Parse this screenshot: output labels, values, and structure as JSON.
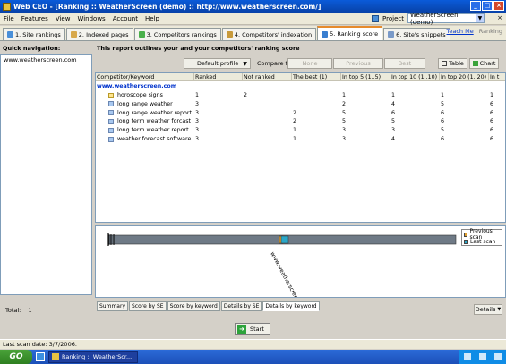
{
  "window": {
    "title": "Web CEO - [Ranking :: WeatherScreen (demo) :: http://www.weatherscreen.com/]"
  },
  "menu": {
    "items": [
      "File",
      "Features",
      "View",
      "Windows",
      "Account",
      "Help"
    ],
    "project_label": "Project",
    "project_value": "WeatherScreen (demo)"
  },
  "tabs": {
    "items": [
      {
        "label": "1. Site rankings"
      },
      {
        "label": "2. Indexed pages"
      },
      {
        "label": "3. Competitors rankings"
      },
      {
        "label": "4. Competitors' indexation"
      },
      {
        "label": "5. Ranking score"
      },
      {
        "label": "6. Site's snippets"
      }
    ],
    "active_index": 4,
    "teach_me": "Teach Me",
    "ranking": "Ranking"
  },
  "left": {
    "heading": "Quick navigation:",
    "items": [
      "www.weatherscreen.com"
    ],
    "total_label": "Total:",
    "total_value": "1"
  },
  "main": {
    "heading": "This report outlines your and your competitors' ranking score",
    "profile": "Default profile",
    "compare_to": "Compare to:",
    "compare_buttons": [
      "None",
      "Previous",
      "Best"
    ],
    "view_buttons": [
      "Table",
      "Chart"
    ]
  },
  "table": {
    "columns": [
      "Competitor/Keyword",
      "Ranked",
      "Not ranked",
      "The best (1)",
      "In top 5 (1..5)",
      "In top 10 (1..10)",
      "In top 20 (1..20)",
      "In t"
    ],
    "site": "www.weatherscreen.com",
    "rows": [
      {
        "keyword": "horoscope signs",
        "icon": "yellow",
        "cells": [
          "1",
          "2",
          "",
          "1",
          "1",
          "1",
          "1"
        ]
      },
      {
        "keyword": "long range weather",
        "icon": "blue",
        "cells": [
          "3",
          "",
          "",
          "2",
          "4",
          "5",
          "6"
        ]
      },
      {
        "keyword": "long range weather report",
        "icon": "blue",
        "cells": [
          "3",
          "",
          "2",
          "5",
          "6",
          "6",
          "6"
        ]
      },
      {
        "keyword": "long term weather forcast",
        "icon": "blue",
        "cells": [
          "3",
          "",
          "2",
          "5",
          "5",
          "6",
          "6"
        ]
      },
      {
        "keyword": "long term weather report",
        "icon": "blue",
        "cells": [
          "3",
          "",
          "1",
          "3",
          "3",
          "5",
          "6"
        ]
      },
      {
        "keyword": "weather forecast software",
        "icon": "blue",
        "cells": [
          "3",
          "",
          "1",
          "3",
          "4",
          "6",
          "6"
        ]
      }
    ]
  },
  "chart_data": {
    "type": "bar",
    "categories": [
      "www.weatherscreen.com"
    ],
    "series": [
      {
        "name": "Previous scan",
        "color": "#e0a030"
      },
      {
        "name": "Last scan",
        "color": "#2aa7c8"
      }
    ]
  },
  "subtabs": {
    "items": [
      "Summary",
      "Score by SE",
      "Score by keyword",
      "Details by SE",
      "Details by keyword"
    ],
    "active_index": 4,
    "details_button": "Details"
  },
  "actions": {
    "start": "Start"
  },
  "status": {
    "text": "Last scan date: 3/7/2006."
  },
  "taskbar": {
    "start": "GO",
    "task": "Ranking :: WeatherScr..."
  }
}
